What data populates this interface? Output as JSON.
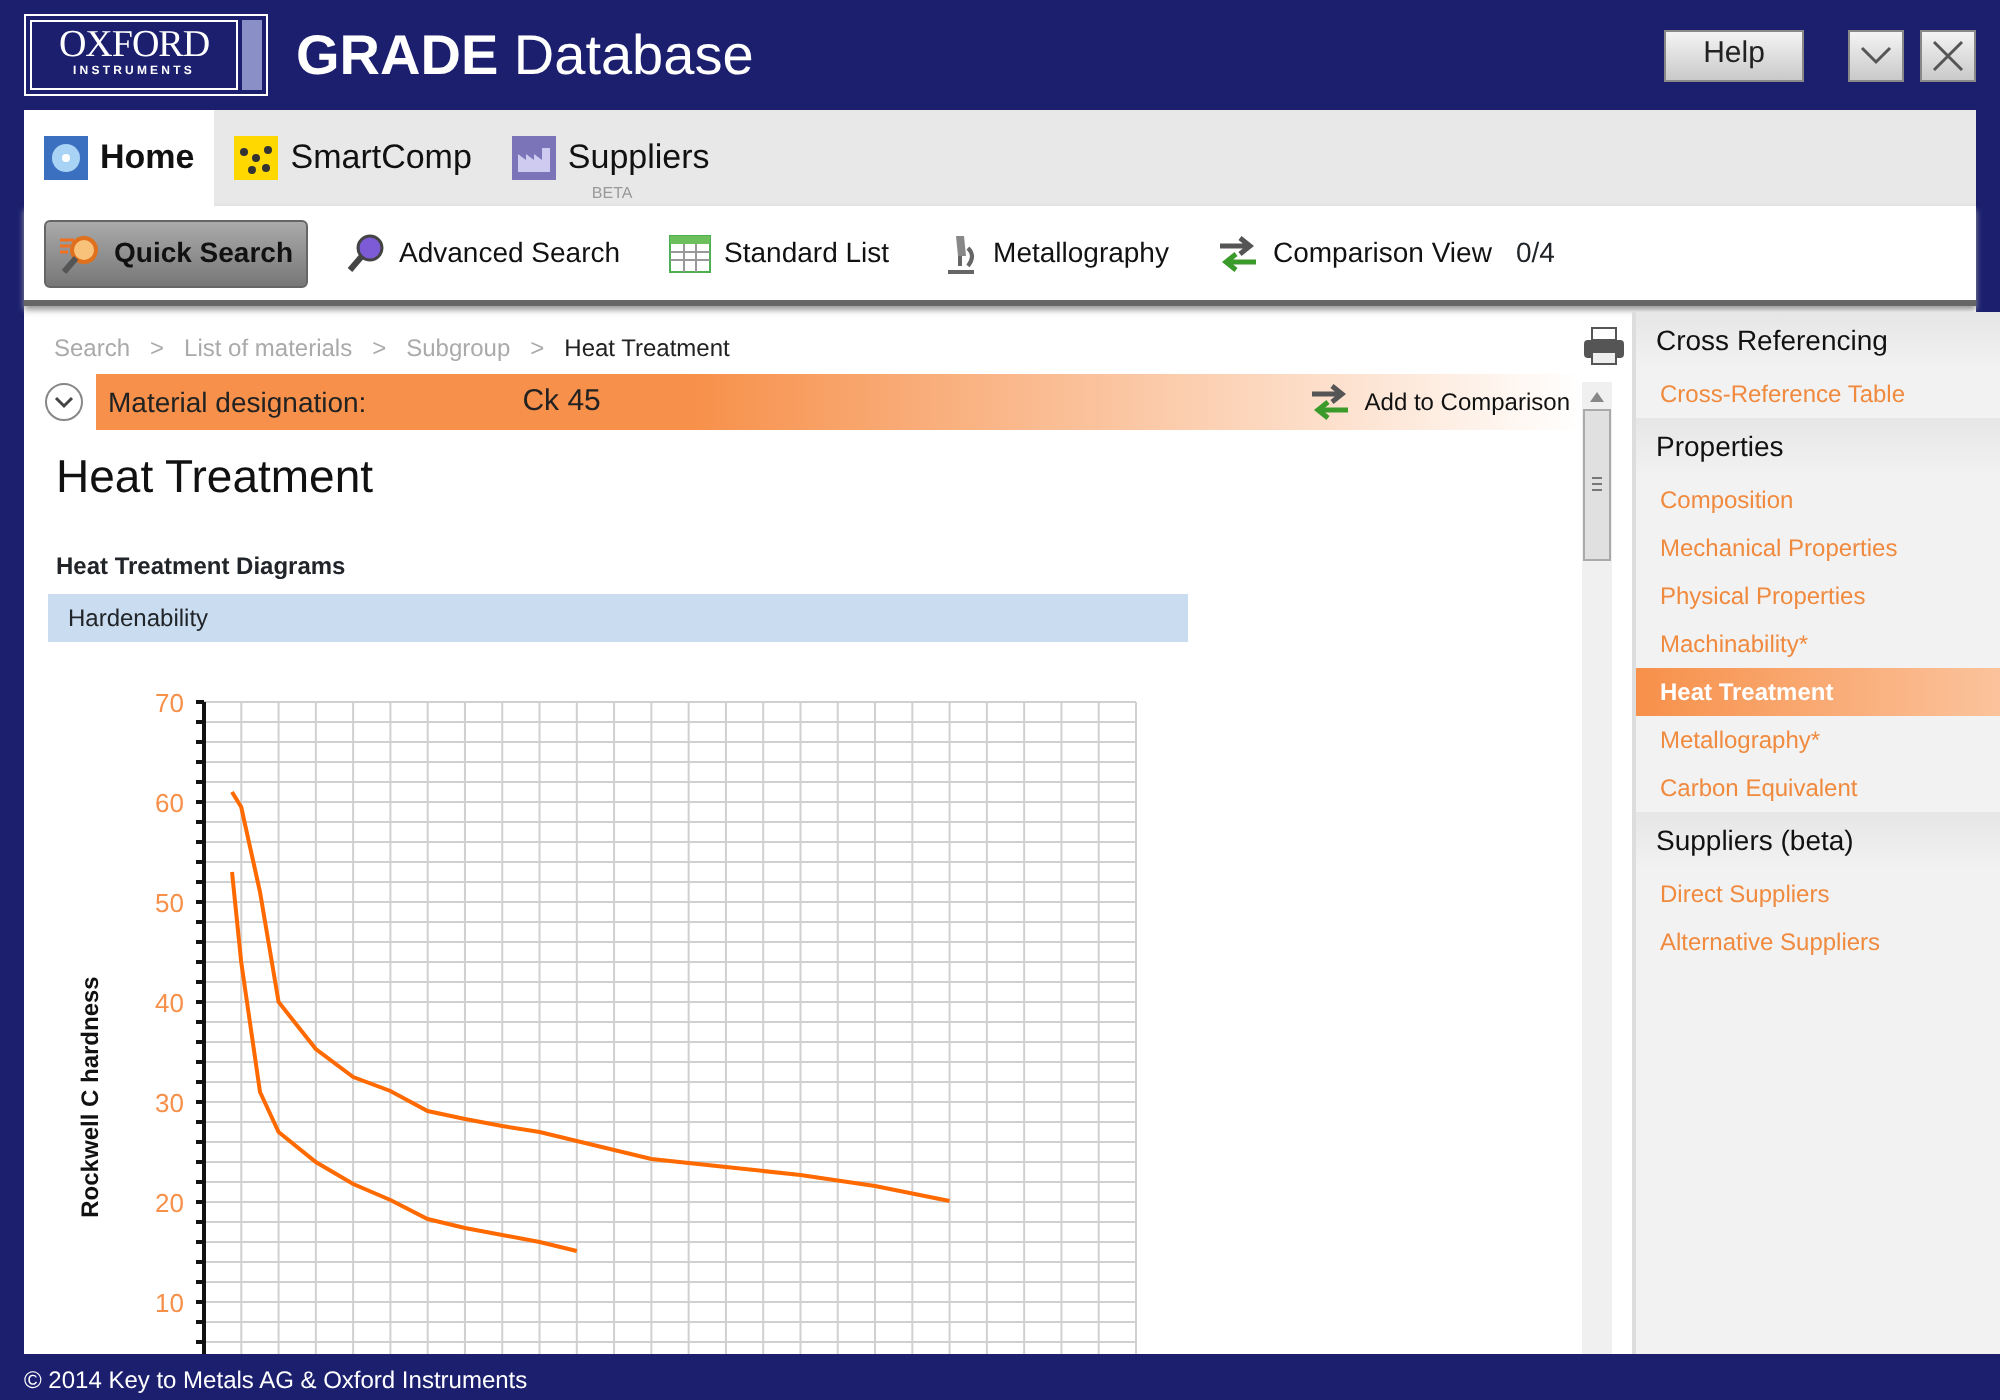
{
  "window": {
    "logo_top": "OXFORD",
    "logo_bottom": "INSTRUMENTS",
    "title_bold": "GRADE",
    "title_rest": "Database",
    "buttons": [
      {
        "kind": "help",
        "label": "Help"
      },
      {
        "kind": "minimize"
      },
      {
        "kind": "close"
      }
    ]
  },
  "tabs": [
    {
      "label": "Home",
      "selected": true
    },
    {
      "label": "SmartComp",
      "selected": false
    },
    {
      "label": "Suppliers",
      "badge": "BETA",
      "selected": false
    }
  ],
  "toolbar": [
    {
      "label": "Quick Search",
      "selected": true
    },
    {
      "label": "Advanced Search",
      "selected": false
    },
    {
      "label": "Standard List",
      "selected": false
    },
    {
      "label": "Metallography",
      "selected": false
    },
    {
      "label": "Comparison View",
      "count": "0/4",
      "selected": false
    }
  ],
  "breadcrumb": [
    {
      "label": "Search",
      "current": false
    },
    {
      "label": "List of materials",
      "current": false
    },
    {
      "label": "Subgroup",
      "current": false
    },
    {
      "label": "Heat Treatment",
      "current": true
    }
  ],
  "breadcrumb_separator": ">",
  "material": {
    "label": "Material designation:",
    "value": "Ck 45",
    "action": "Add to Comparison"
  },
  "heading": "Heat Treatment",
  "section_title": "Heat Treatment Diagrams",
  "subsection": "Hardenability",
  "chart": {
    "ylabel": "Rockwell C hardness",
    "y_tick_labels": [
      "70",
      "60",
      "50",
      "40",
      "30",
      "20",
      "10"
    ]
  },
  "sidebar": {
    "sections": [
      {
        "title": "Cross Referencing",
        "items": [
          {
            "label": "Cross-Reference Table",
            "selected": false
          }
        ]
      },
      {
        "title": "Properties",
        "items": [
          {
            "label": "Composition",
            "selected": false
          },
          {
            "label": "Mechanical Properties",
            "selected": false
          },
          {
            "label": "Physical Properties",
            "selected": false
          },
          {
            "label": "Machinability*",
            "selected": false
          },
          {
            "label": "Heat Treatment",
            "selected": true
          },
          {
            "label": "Metallography*",
            "selected": false
          },
          {
            "label": "Carbon Equivalent",
            "selected": false
          }
        ]
      },
      {
        "title": "Suppliers (beta)",
        "items": [
          {
            "label": "Direct Suppliers",
            "selected": false
          },
          {
            "label": "Alternative Suppliers",
            "selected": false
          }
        ]
      }
    ]
  },
  "status_bar": "© 2014 Key to Metals AG & Oxford Instruments"
}
